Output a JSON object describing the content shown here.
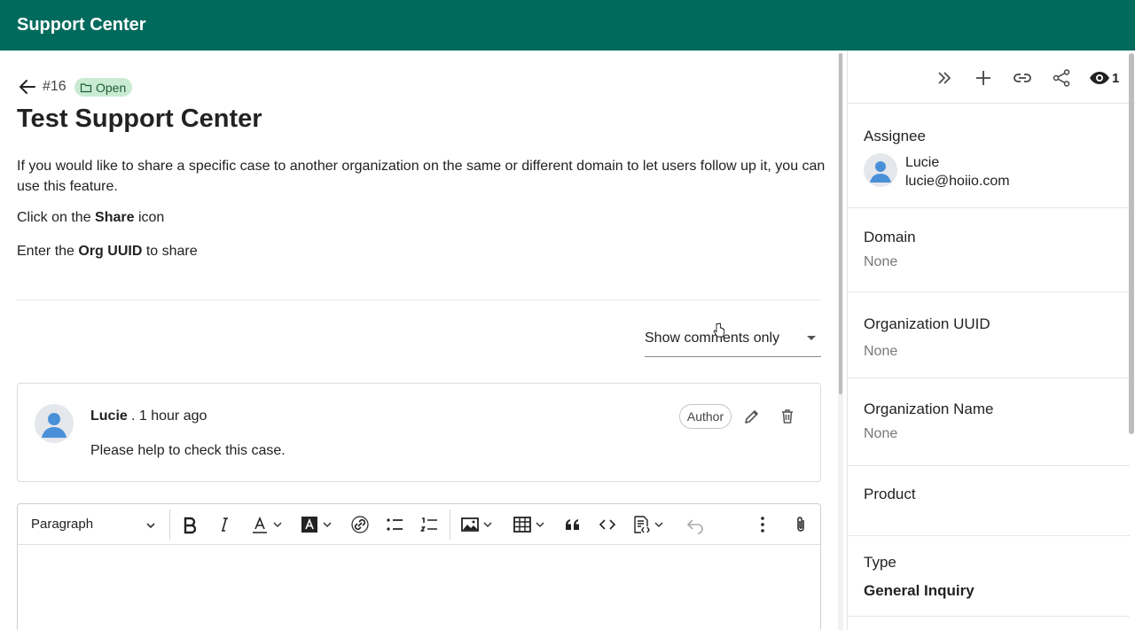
{
  "header": {
    "app_title": "Support Center"
  },
  "case": {
    "number": "#16",
    "status": "Open",
    "title": "Test Support Center",
    "description": "If you would like to share a specific case to another organization on the same or different domain to let users follow up it, you can use this feature.",
    "step1": {
      "prefix": "Click on the ",
      "bold": "Share",
      "suffix": " icon"
    },
    "step2": {
      "prefix": "Enter the ",
      "bold": "Org UUID",
      "suffix": " to share"
    }
  },
  "filter": {
    "selected": "Show comments only"
  },
  "comment": {
    "author": "Lucie",
    "time": ". 1 hour ago",
    "body": "Please help to check this case.",
    "role_chip": "Author"
  },
  "editor": {
    "block_type": "Paragraph",
    "toolbar_icons": [
      "bold-icon",
      "italic-icon",
      "font-color-icon",
      "highlight-icon",
      "link-icon",
      "bulleted-list-icon",
      "numbered-list-icon",
      "image-icon",
      "table-icon",
      "quote-icon",
      "code-icon",
      "source-icon",
      "undo-icon",
      "more-icon",
      "attach-icon"
    ]
  },
  "sidebar": {
    "watchers_count": "1",
    "assignee": {
      "label": "Assignee",
      "name": "Lucie",
      "email": "lucie@hoiio.com"
    },
    "domain": {
      "label": "Domain",
      "value": "None"
    },
    "org_uuid": {
      "label": "Organization UUID",
      "value": "None"
    },
    "org_name": {
      "label": "Organization Name",
      "value": "None"
    },
    "product": {
      "label": "Product",
      "value": ""
    },
    "type": {
      "label": "Type",
      "value": "General Inquiry"
    }
  },
  "colors": {
    "header_bg": "#006a5c",
    "status_bg": "#c8ebd2",
    "status_text": "#1d5d34"
  }
}
